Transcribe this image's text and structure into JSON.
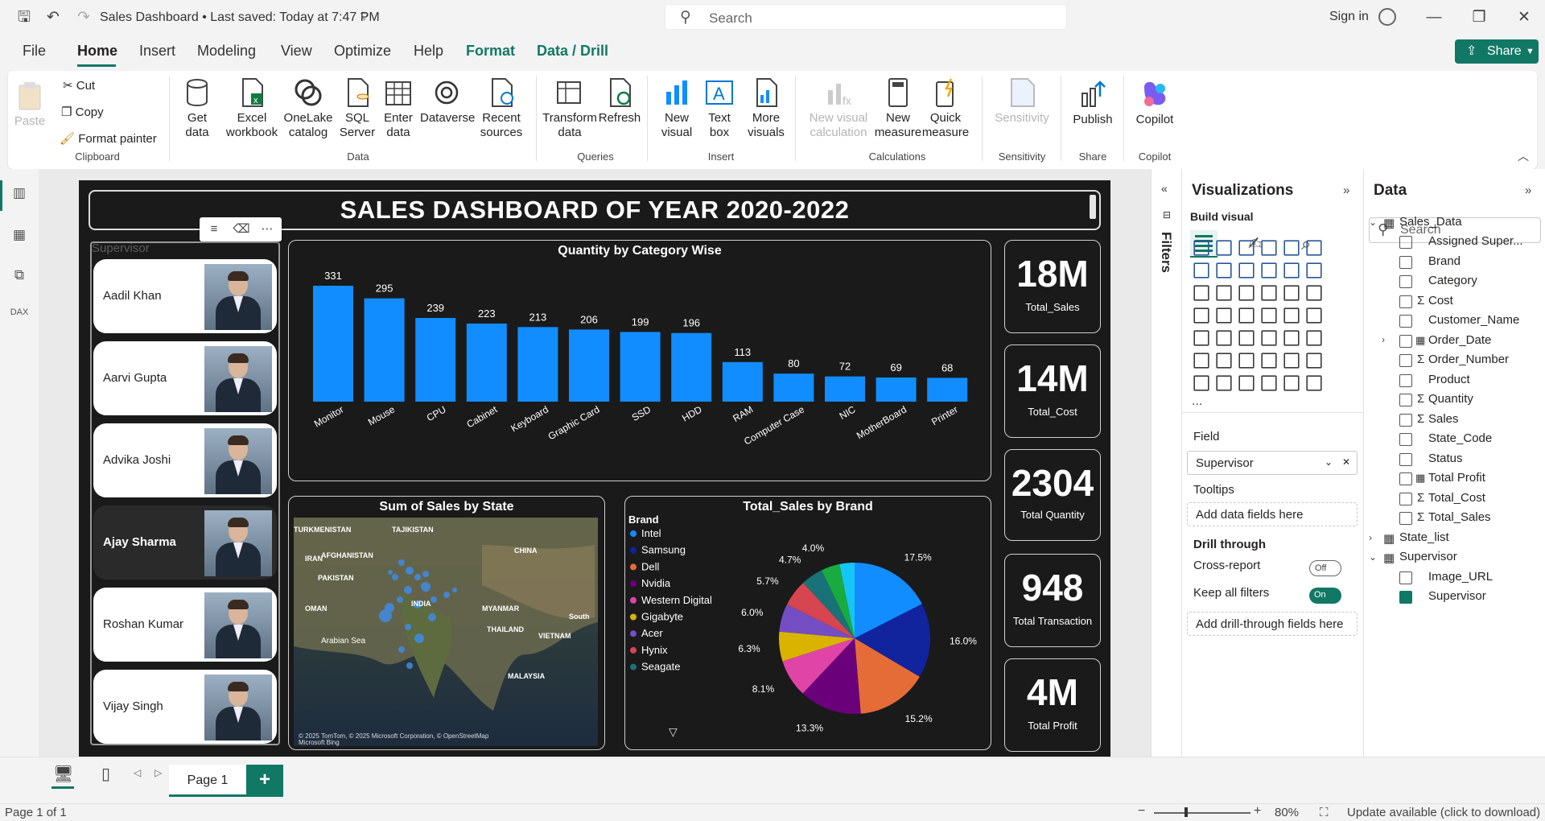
{
  "titlebar": {
    "doc_title": "Sales Dashboard • Last saved: Today at 7:47 PM",
    "search_placeholder": "Search",
    "sign_in": "Sign in"
  },
  "menus": [
    "File",
    "Home",
    "Insert",
    "Modeling",
    "View",
    "Optimize",
    "Help",
    "Format",
    "Data / Drill"
  ],
  "share_label": "Share",
  "ribbon": {
    "paste": "Paste",
    "cut": "Cut",
    "copy": "Copy",
    "format_painter": "Format painter",
    "clipboard": "Clipboard",
    "get_data": "Get data",
    "excel": "Excel workbook",
    "onelake": "OneLake catalog",
    "sql": "SQL Server",
    "enter_data": "Enter data",
    "dataverse": "Dataverse",
    "recent": "Recent sources",
    "data_group": "Data",
    "transform": "Transform data",
    "refresh": "Refresh",
    "queries": "Queries",
    "new_visual": "New visual",
    "text_box": "Text box",
    "more_visuals": "More visuals",
    "insert": "Insert",
    "new_calc": "New visual calculation",
    "new_measure": "New measure",
    "quick_measure": "Quick measure",
    "calculations": "Calculations",
    "sensitivity_btn": "Sensitivity",
    "sensitivity": "Sensitivity",
    "publish": "Publish",
    "share": "Share",
    "copilot_btn": "Copilot",
    "copilot": "Copilot"
  },
  "dashboard": {
    "title": "SALES DASHBOARD OF YEAR 2020-2022",
    "supervisor_label": "Supervisor",
    "supervisors": [
      "Aadil Khan",
      "Aarvi Gupta",
      "Advika Joshi",
      "Ajay Sharma",
      "Roshan Kumar",
      "Vijay Singh"
    ],
    "selected_supervisor": "Ajay Sharma",
    "bar_title": "Quantity by Category Wise",
    "map_title": "Sum of Sales by State",
    "pie_title": "Total_Sales by Brand",
    "legend_title": "Brand",
    "map_labels": [
      "TURKMENISTAN",
      "TAJIKISTAN",
      "AFGHANISTAN",
      "IRAN",
      "PAKISTAN",
      "CHINA",
      "OMAN",
      "INDIA",
      "MYANMAR",
      "THAILAND",
      "VIETNAM",
      "Arabian Sea",
      "MALAYSIA",
      "South"
    ],
    "map_attribution": "© 2025 TomTom, © 2025 Microsoft Corporation, © OpenStreetMap",
    "map_provider": "Microsoft Bing",
    "kpis": [
      {
        "value": "18M",
        "label": "Total_Sales"
      },
      {
        "value": "14M",
        "label": "Total_Cost"
      },
      {
        "value": "2304",
        "label": "Total Quantity"
      },
      {
        "value": "948",
        "label": "Total Transaction"
      },
      {
        "value": "4M",
        "label": "Total Profit"
      }
    ]
  },
  "chart_data": [
    {
      "type": "bar",
      "title": "Quantity by Category Wise",
      "categories": [
        "Monitor",
        "Mouse",
        "CPU",
        "Cabinet",
        "Keyboard",
        "Graphic Card",
        "SSD",
        "HDD",
        "RAM",
        "Computer Case",
        "NIC",
        "MotherBoard",
        "Printer"
      ],
      "values": [
        331,
        295,
        239,
        223,
        213,
        206,
        199,
        196,
        113,
        80,
        72,
        69,
        68
      ],
      "ylim": [
        0,
        331
      ],
      "color": "#118dff"
    },
    {
      "type": "pie",
      "title": "Total_Sales by Brand",
      "legend": [
        "Intel",
        "Samsung",
        "Dell",
        "Nvidia",
        "Western Digital",
        "Gigabyte",
        "Acer",
        "Hynix",
        "Seagate"
      ],
      "slices": [
        {
          "name": "",
          "value": 17.5,
          "label": "17.5%",
          "color": "#118dff"
        },
        {
          "name": "",
          "value": 16.0,
          "label": "16.0%",
          "color": "#12239e"
        },
        {
          "name": "",
          "value": 15.2,
          "label": "15.2%",
          "color": "#e66c37"
        },
        {
          "name": "",
          "value": 13.3,
          "label": "13.3%",
          "color": "#6b007b"
        },
        {
          "name": "",
          "value": 8.1,
          "label": "8.1%",
          "color": "#e044a7"
        },
        {
          "name": "",
          "value": 6.3,
          "label": "6.3%",
          "color": "#d9b300"
        },
        {
          "name": "",
          "value": 6.0,
          "label": "6.0%",
          "color": "#744ec2"
        },
        {
          "name": "",
          "value": 5.7,
          "label": "5.7%",
          "color": "#d64550"
        },
        {
          "name": "",
          "value": 4.7,
          "label": "4.7%",
          "color": "#197278"
        },
        {
          "name": "",
          "value": 4.0,
          "label": "4.0%",
          "color": "#1aab40"
        },
        {
          "name": "",
          "value": 3.2,
          "label": "",
          "color": "#15c6f4"
        }
      ],
      "legend_colors": [
        "#118dff",
        "#12239e",
        "#e66c37",
        "#6b007b",
        "#e044a7",
        "#d9b300",
        "#744ec2",
        "#d64550",
        "#197278"
      ]
    }
  ],
  "visualizations": {
    "title": "Visualizations",
    "build": "Build visual",
    "field_label": "Field",
    "field_value": "Supervisor",
    "tooltips": "Tooltips",
    "tooltips_add": "Add data fields here",
    "drill": "Drill through",
    "cross": "Cross-report",
    "cross_state": "Off",
    "keep": "Keep all filters",
    "keep_state": "On",
    "drill_add": "Add drill-through fields here",
    "more": "..."
  },
  "filters_label": "Filters",
  "data_pane": {
    "title": "Data",
    "search_placeholder": "Search",
    "tables": [
      {
        "name": "Sales_Data",
        "fields": [
          "Assigned Super...",
          "Brand",
          "Category",
          "Cost",
          "Customer_Name",
          "Order_Date",
          "Order_Number",
          "Product",
          "Quantity",
          "Sales",
          "State_Code",
          "Status",
          "Total Profit",
          "Total_Cost",
          "Total_Sales"
        ]
      },
      {
        "name": "State_list",
        "fields": []
      },
      {
        "name": "Supervisor",
        "fields": [
          "Image_URL",
          "Supervisor"
        ]
      }
    ]
  },
  "pages": {
    "current": "Page 1",
    "add": "+"
  },
  "status": {
    "page": "Page 1 of 1",
    "zoom": "80%",
    "update": "Update available (click to download)"
  }
}
